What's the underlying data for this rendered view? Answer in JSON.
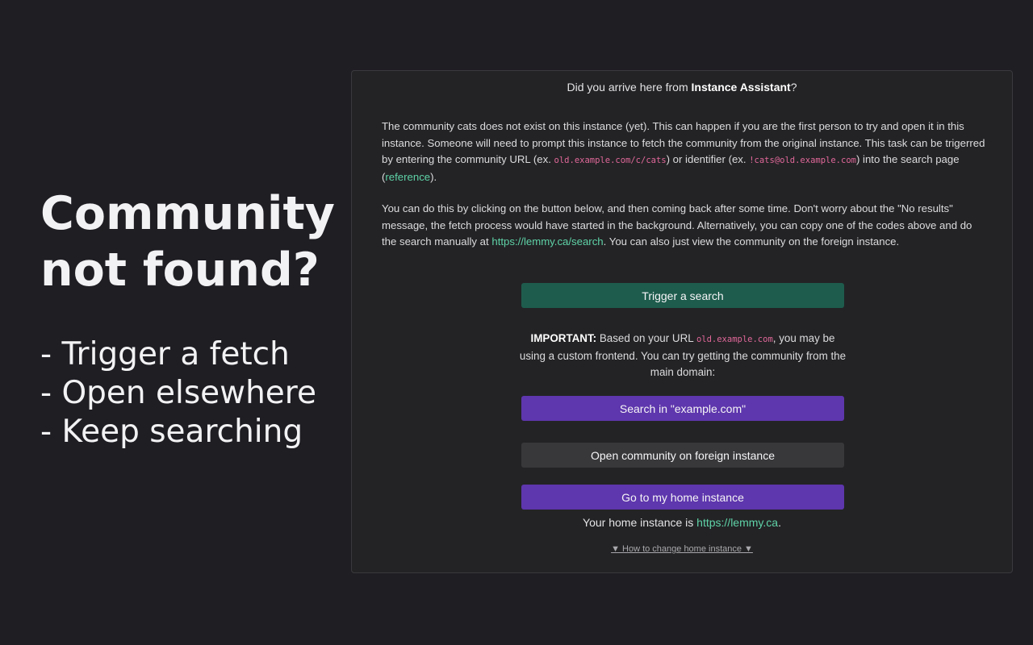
{
  "hero": {
    "title_line1": "Community",
    "title_line2": "not found?",
    "bullets": [
      "- Trigger a fetch",
      "- Open elsewhere",
      "- Keep searching"
    ]
  },
  "panel": {
    "header_prefix": "Did you arrive here from ",
    "header_bold": "Instance Assistant",
    "header_suffix": "?",
    "para1": {
      "t1": "The community cats does not exist on this instance (yet). This can happen if you are the first person to try and open it in this instance. Someone will need to prompt this instance to fetch the community from the original instance. This task can be trigerred by entering the community URL (ex. ",
      "code_url": "old.example.com/c/cats",
      "t2": ") or identifier (ex. ",
      "code_id": "!cats@old.example.com",
      "t3": ") into the search page (",
      "link_reference": "reference",
      "t4": ")."
    },
    "para2": {
      "t1": "You can do this by clicking on the button below, and then coming back after some time. Don't worry about the \"No results\" message, the fetch process would have started in the background. Alternatively, you can copy one of the codes above and do the search manually at ",
      "link_search": "https://lemmy.ca/search",
      "t2": ". You can also just view the community on the foreign instance."
    },
    "trigger_button": "Trigger a search",
    "important": {
      "label": "IMPORTANT:",
      "t1": " Based on your URL ",
      "code_domain": "old.example.com",
      "t2": ", you may be using a custom frontend. You can try getting the community from the main domain:"
    },
    "search_main_button": "Search in \"example.com\"",
    "open_foreign_button": "Open community on foreign instance",
    "home_button": "Go to my home instance",
    "home_prefix": "Your home instance is ",
    "home_link": "https://lemmy.ca",
    "home_suffix": ".",
    "howto_label": "▼ How to change home instance ▼"
  },
  "colors": {
    "background": "#1f1e23",
    "panel": "#232325",
    "trigger_button": "#1e5c4d",
    "primary_button": "#5e36ad",
    "secondary_button": "#38383b",
    "link": "#5fd3a8",
    "code": "#e1689a"
  }
}
